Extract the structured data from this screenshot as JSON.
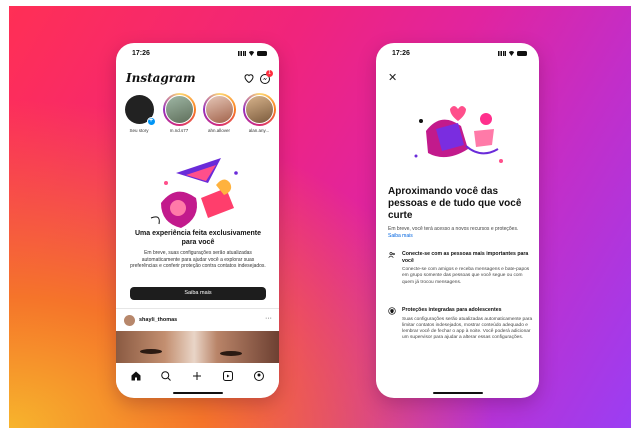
{
  "left_phone": {
    "time": "17:26",
    "logo": "Instagram",
    "message_badge": "1",
    "stories": [
      {
        "name": "Seu story"
      },
      {
        "name": "m.nd.s77"
      },
      {
        "name": "ahn.allover"
      },
      {
        "name": "alan.any..."
      }
    ],
    "promo": {
      "title": "Uma experiência feita exclusivamente para você",
      "body": "Em breve, suas configurações serão atualizadas automaticamente para ajudar você a explorar suas preferências e conferir proteção contra contatos indesejados.",
      "button": "Saiba mais"
    },
    "post": {
      "username": "shayli_thomas",
      "more": "···"
    },
    "tabs": [
      "home",
      "search",
      "create",
      "reels",
      "profile"
    ]
  },
  "right_phone": {
    "time": "17:26",
    "title": "Aproximando você das pessoas e de tudo que você curte",
    "intro": "Em breve, você terá acesso a novos recursos e proteções.",
    "intro_link": "Saiba mais",
    "features": [
      {
        "icon": "people-icon",
        "title": "Conecte-se com as pessoas mais importantes para você",
        "body": "Conecte-se com amigos e receba mensagens e bate-papos em grupo somente das pessoas que você segue ou com quem já trocou mensagens."
      },
      {
        "icon": "shield-icon",
        "title": "Proteções integradas para adolescentes",
        "body": "Suas configurações serão atualizadas automaticamente para limitar contatos indesejados, mostrar conteúdo adequado e lembrar você de fechar o app à noite. Você poderá adicionar um supervisor para ajudar a alterar essas configurações."
      }
    ]
  },
  "colors": {
    "gradient_start": "#ff2f55",
    "gradient_mid": "#e1249f",
    "gradient_end": "#9b3ef3",
    "button_dark": "#1d1d1d",
    "link_blue": "#0064e0"
  }
}
